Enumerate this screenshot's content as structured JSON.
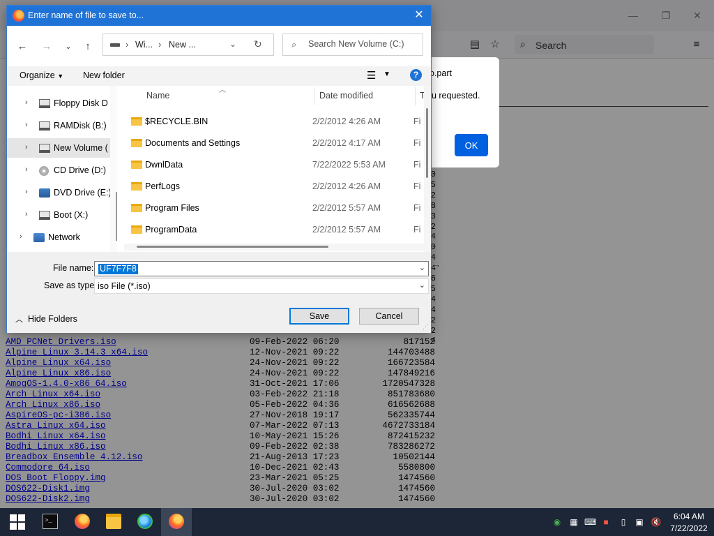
{
  "browser": {
    "search_placeholder": "Search",
    "listing": [
      {
        "name": "AMD PCNet Drivers.iso",
        "date": "09-Feb-2022 06:20",
        "size": "817152"
      },
      {
        "name": "Alpine Linux 3.14.3 x64.iso",
        "date": "12-Nov-2021 09:22",
        "size": "144703488"
      },
      {
        "name": "Alpine Linux x64.iso",
        "date": "24-Nov-2021 09:22",
        "size": "166723584"
      },
      {
        "name": "Alpine Linux x86.iso",
        "date": "24-Nov-2021 09:22",
        "size": "147849216"
      },
      {
        "name": "AmogOS-1.4.0-x86_64.iso",
        "date": "31-Oct-2021 17:06",
        "size": "1720547328"
      },
      {
        "name": "Arch Linux x64.iso",
        "date": "03-Feb-2022 21:18",
        "size": "851783680"
      },
      {
        "name": "Arch Linux x86.iso",
        "date": "05-Feb-2022 04:36",
        "size": "616562688"
      },
      {
        "name": "AspireOS-pc-i386.iso",
        "date": "27-Nov-2018 19:17",
        "size": "562335744"
      },
      {
        "name": "Astra Linux x64.iso",
        "date": "07-Mar-2022 07:13",
        "size": "4672733184"
      },
      {
        "name": "Bodhi Linux x64.iso",
        "date": "10-May-2021 15:26",
        "size": "872415232"
      },
      {
        "name": "Bodhi Linux x86.iso",
        "date": "09-Feb-2022 02:38",
        "size": "783286272"
      },
      {
        "name": "Breadbox Ensemble 4.12.iso",
        "date": "21-Aug-2013 17:23",
        "size": "10502144"
      },
      {
        "name": "Commodore 64.iso",
        "date": "10-Dec-2021 02:43",
        "size": "5580800"
      },
      {
        "name": "DOS Boot Floppy.img",
        "date": "23-Mar-2021 05:25",
        "size": "1474560"
      },
      {
        "name": "DOS622-Disk1.img",
        "date": "30-Jul-2020 03:02",
        "size": "1474560"
      },
      {
        "name": "DOS622-Disk2.img",
        "date": "30-Jul-2020 03:02",
        "size": "1474560"
      }
    ],
    "peek_digits": [
      "0",
      "5",
      "2",
      "8",
      "3",
      "2",
      "4",
      "0",
      "4",
      "4",
      "6",
      "5",
      "4",
      "4",
      "2",
      "2",
      "4"
    ]
  },
  "alert": {
    "text_line1": "o.part",
    "text_line2": "ou requested.",
    "ok_label": "OK"
  },
  "dialog": {
    "title": "Enter name of file to save to...",
    "breadcrumb": [
      "Wi...",
      "New ..."
    ],
    "search_placeholder": "Search New Volume (C:)",
    "organize_label": "Organize",
    "new_folder_label": "New folder",
    "help_label": "?",
    "tree": [
      {
        "label": "Floppy Disk D",
        "icon": "floppy-icon"
      },
      {
        "label": "RAMDisk (B:)",
        "icon": "drive-icon"
      },
      {
        "label": "New Volume (",
        "icon": "drive-icon",
        "selected": true
      },
      {
        "label": "CD Drive (D:)",
        "icon": "cd-icon"
      },
      {
        "label": "DVD Drive (E:)",
        "icon": "dvd-icon"
      },
      {
        "label": "Boot (X:)",
        "icon": "drive-icon"
      },
      {
        "label": "Network",
        "icon": "network-icon"
      }
    ],
    "columns": {
      "name": "Name",
      "date": "Date modified",
      "type": "Ty"
    },
    "files": [
      {
        "name": "$RECYCLE.BIN",
        "date": "2/2/2012 4:26 AM",
        "type": "Fi"
      },
      {
        "name": "Documents and Settings",
        "date": "2/2/2012 4:17 AM",
        "type": "Fi"
      },
      {
        "name": "DwnlData",
        "date": "7/22/2022 5:53 AM",
        "type": "Fi"
      },
      {
        "name": "PerfLogs",
        "date": "2/2/2012 4:26 AM",
        "type": "Fi"
      },
      {
        "name": "Program Files",
        "date": "2/2/2012 5:57 AM",
        "type": "Fi"
      },
      {
        "name": "ProgramData",
        "date": "2/2/2012 5:57 AM",
        "type": "Fi"
      }
    ],
    "file_name_label": "File name:",
    "file_name_value": "UF7F7F8",
    "save_type_label": "Save as type:",
    "save_type_value": "iso File (*.iso)",
    "hide_folders_label": "Hide Folders",
    "save_label": "Save",
    "cancel_label": "Cancel"
  },
  "taskbar": {
    "clock_time": "6:04 AM",
    "clock_date": "7/22/2022"
  }
}
